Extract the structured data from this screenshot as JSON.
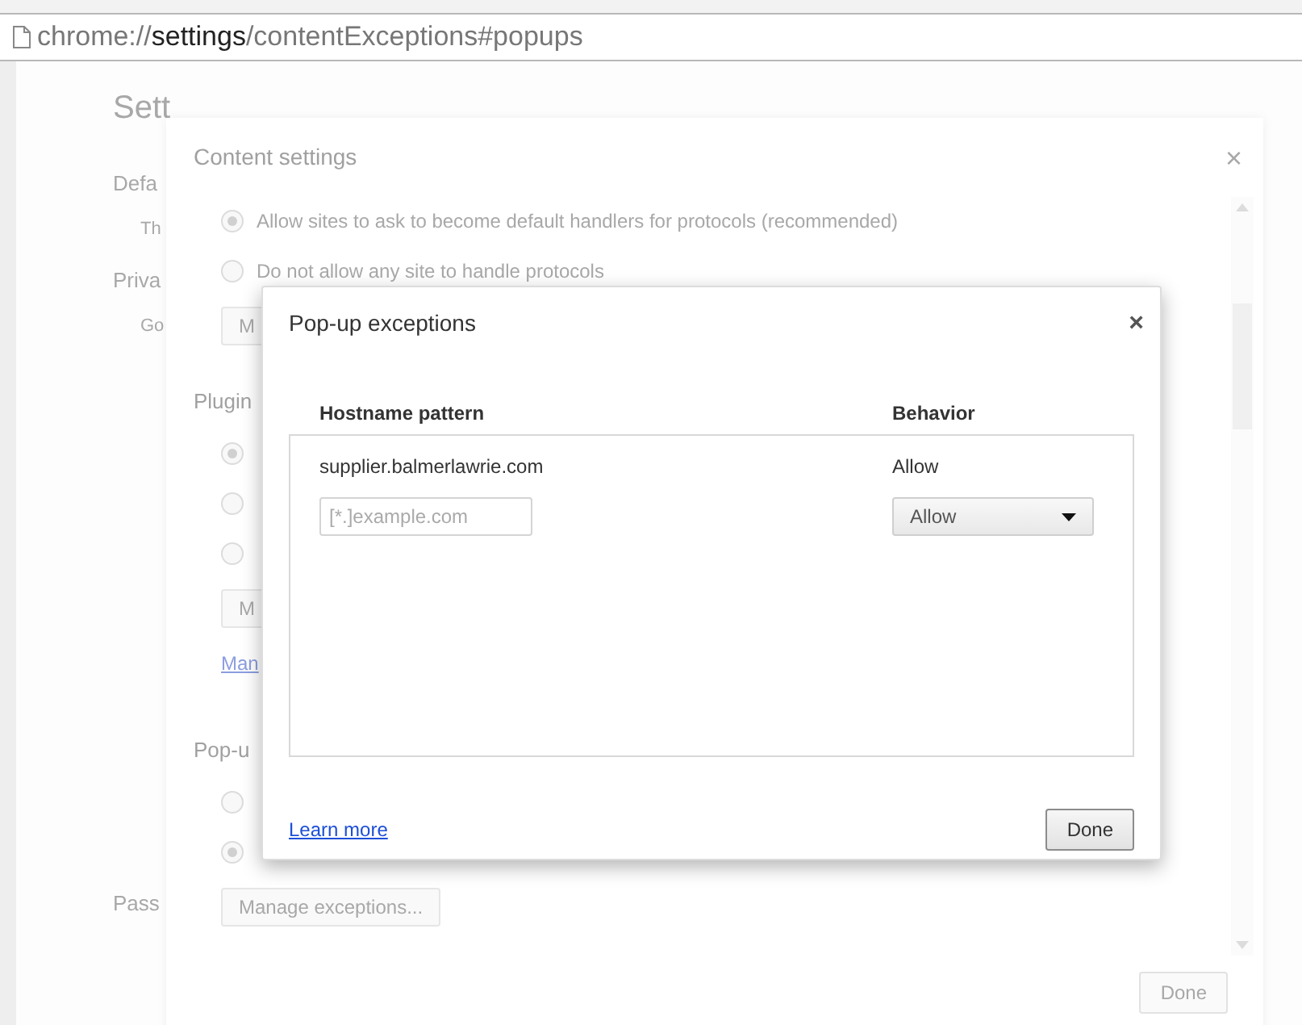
{
  "address_bar": {
    "scheme": "chrome://",
    "host": "settings",
    "path": "/contentExceptions#popups"
  },
  "settings_page": {
    "title": "Sett",
    "sections": [
      {
        "label": "Defa",
        "text": "Th"
      },
      {
        "label": "Priva",
        "text": "Go"
      },
      {
        "label": "Pass"
      }
    ]
  },
  "content_settings": {
    "title": "Content settings",
    "close": "×",
    "items": [
      {
        "kind": "radio",
        "label": "Allow sites to ask to become default handlers for protocols (recommended)",
        "checked": true
      },
      {
        "kind": "radio",
        "label": "Do not allow any site to handle protocols",
        "checked": false
      },
      {
        "kind": "button",
        "label": "M"
      },
      {
        "kind": "heading",
        "label": "Plugin"
      },
      {
        "kind": "radio",
        "checked": true
      },
      {
        "kind": "radio",
        "checked": false
      },
      {
        "kind": "radio",
        "checked": false
      },
      {
        "kind": "button",
        "label": "M"
      },
      {
        "kind": "link",
        "label": "Man"
      },
      {
        "kind": "heading",
        "label": "Pop-u"
      },
      {
        "kind": "radio",
        "checked": false
      },
      {
        "kind": "radio",
        "checked": true
      },
      {
        "kind": "button",
        "label": "Manage exceptions..."
      }
    ],
    "done": "Done"
  },
  "popup_exceptions": {
    "title": "Pop-up exceptions",
    "close": "×",
    "columns": [
      "Hostname pattern",
      "Behavior"
    ],
    "rows": [
      {
        "hostname": "supplier.balmerlawrie.com",
        "behavior": "Allow"
      }
    ],
    "new_entry": {
      "placeholder": "[*.]example.com",
      "behavior": "Allow"
    },
    "learn_more": "Learn more",
    "done": "Done"
  }
}
